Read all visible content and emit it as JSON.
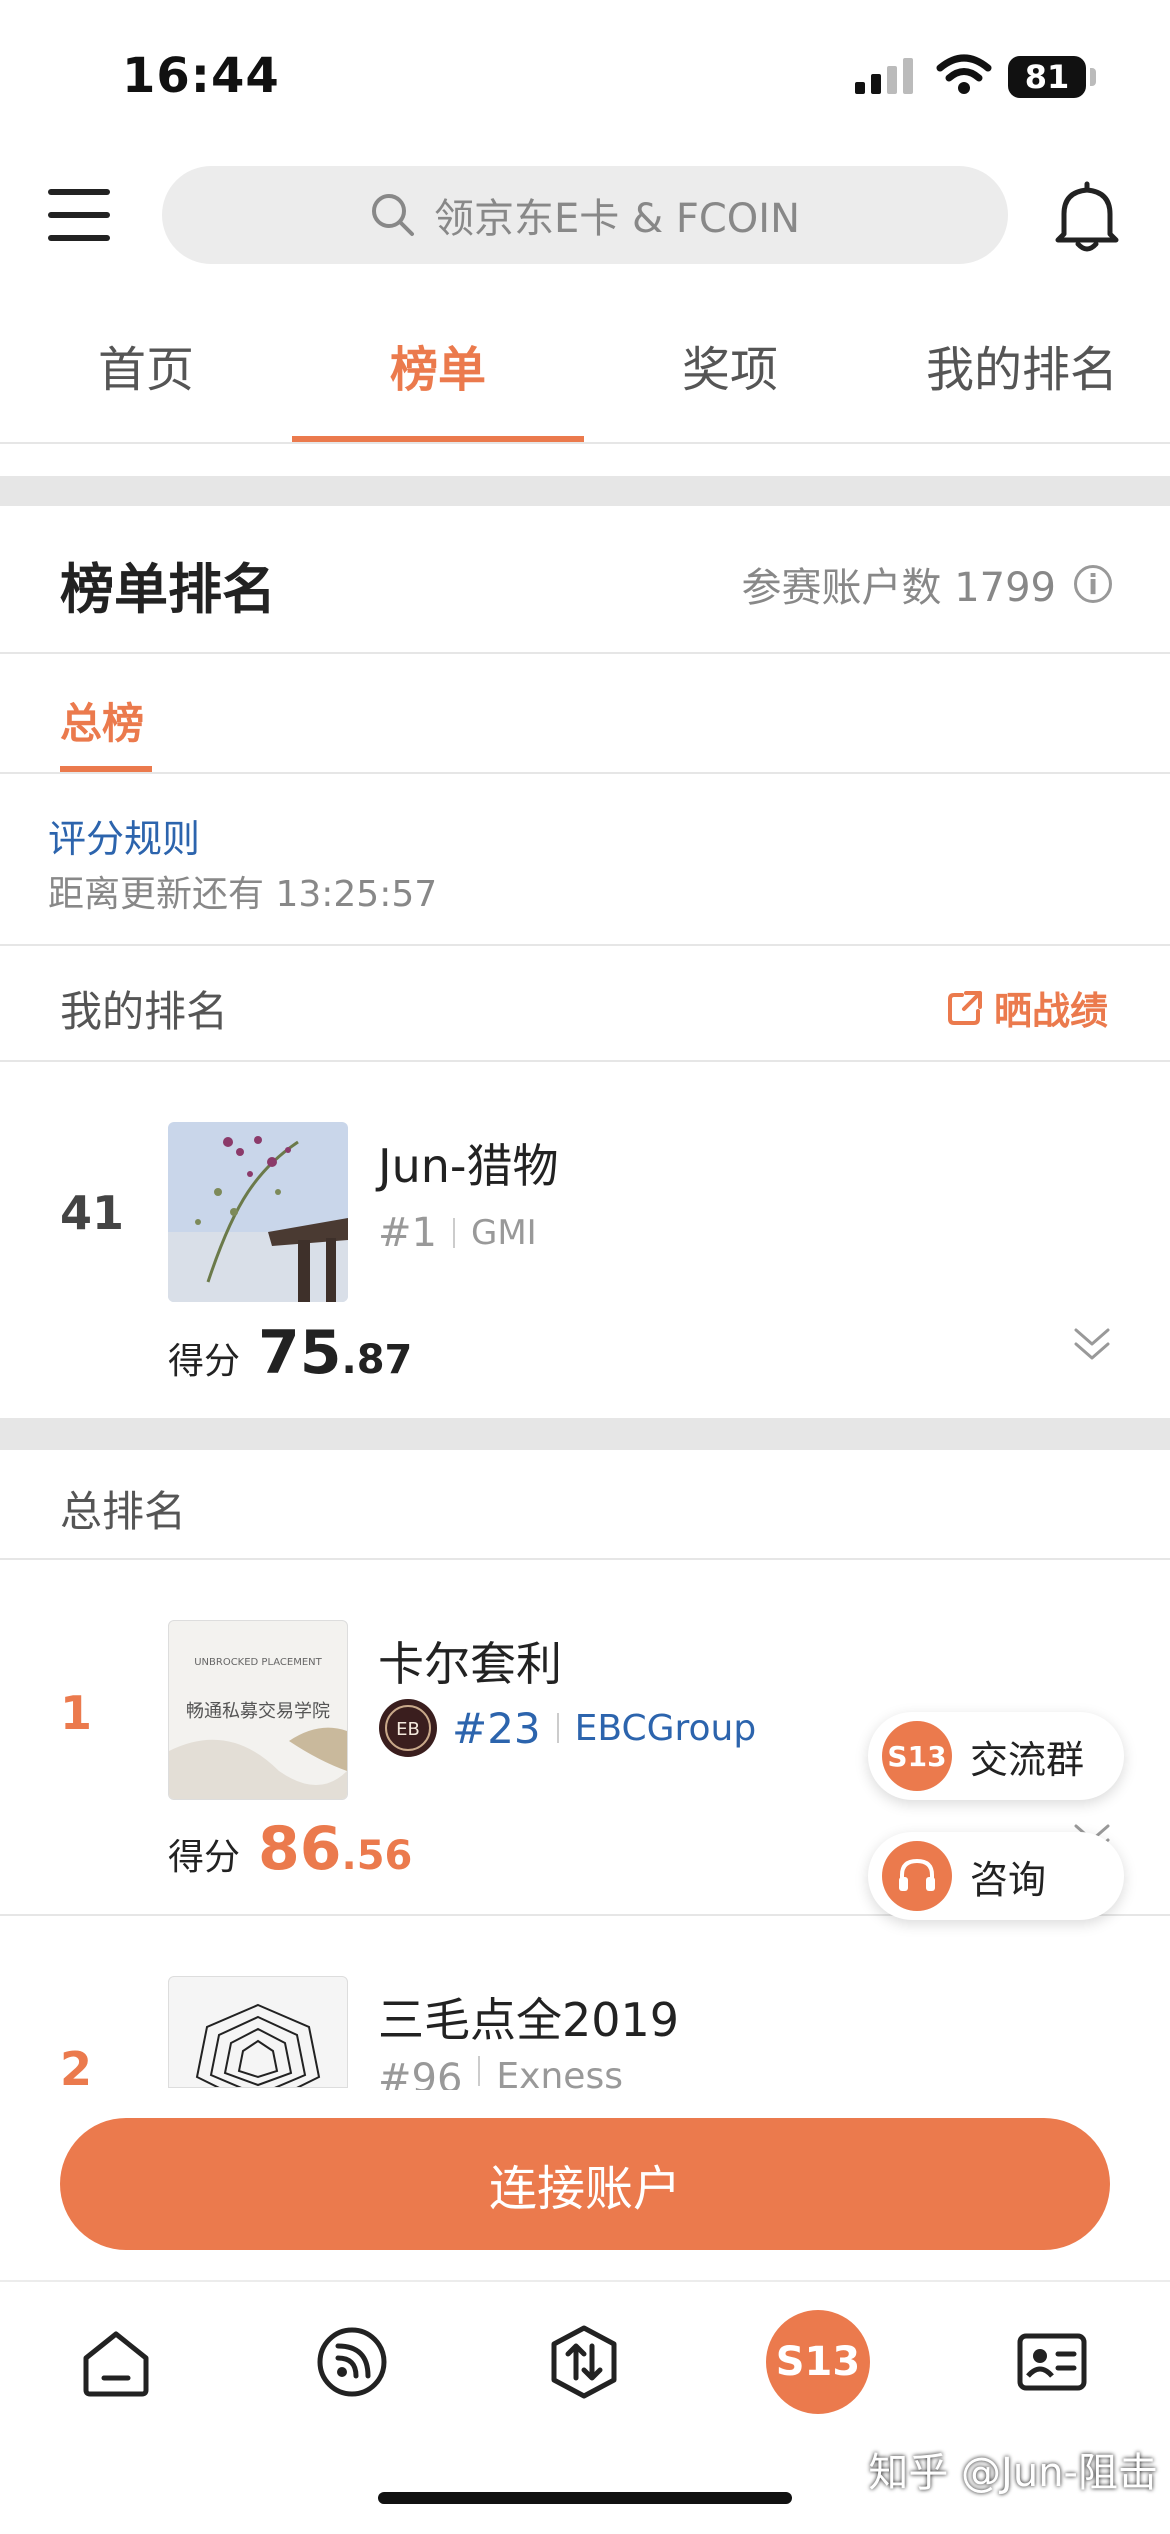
{
  "status_bar": {
    "time": "16:44",
    "battery": "81"
  },
  "search": {
    "placeholder": "领京东E卡 & FCOIN"
  },
  "tabs": [
    {
      "label": "首页"
    },
    {
      "label": "榜单"
    },
    {
      "label": "奖项"
    },
    {
      "label": "我的排名"
    }
  ],
  "ranking": {
    "title": "榜单排名",
    "participants": "参赛账户数 1799",
    "subtab": "总榜",
    "rules_link": "评分规则",
    "countdown": "距离更新还有 13:25:57"
  },
  "my_ranking": {
    "label": "我的排名",
    "share": "晒战绩",
    "rank": "41",
    "name": "Jun-猎物",
    "tag": "#1",
    "broker": "GMI",
    "score_label": "得分",
    "score_int": "75",
    "score_dec": ".87"
  },
  "overall": {
    "label": "总排名",
    "entries": [
      {
        "rank": "1",
        "name": "卡尔套利",
        "tag": "#23",
        "broker": "EBCGroup",
        "score_label": "得分",
        "score_int": "86",
        "score_dec": ".56",
        "avatar_text": "畅通私募交易学院",
        "avatar_header": "UNBROCKED PLACEMENT"
      },
      {
        "rank": "2",
        "name": "三毛点全2019",
        "tag": "#96",
        "broker": "Exness"
      }
    ]
  },
  "floating": {
    "group": "交流群",
    "consult": "咨询",
    "badge": "S13"
  },
  "connect_button": "连接账户",
  "bottom_nav": {
    "center_badge": "S13"
  },
  "watermark": "知乎 @Jun-阻击",
  "colors": {
    "accent": "#eb7a4d",
    "link": "#2c64ad"
  }
}
